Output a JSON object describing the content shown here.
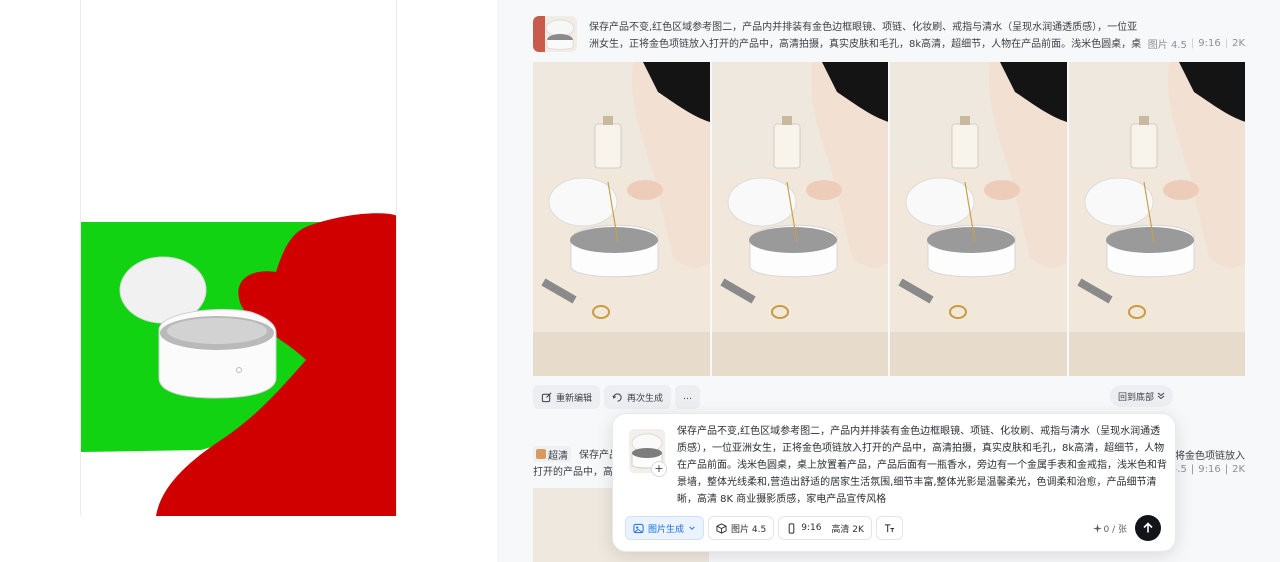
{
  "reference": {
    "region_colors": {
      "green": "#11d311",
      "red": "#d10000"
    },
    "product_name": "ultrasonic-cleaner"
  },
  "result": {
    "prompt": "保存产品不变,红色区域参考图二，产品内并排装有金色边框眼镜、项链、化妆刷、戒指与清水（呈现水润通透质感），一位亚洲女生，正将金色项链放入打开的产品中，高清拍摄，真实皮肤和毛孔，8k高清，超细节，人物在产品前面。浅米色圆桌，桌上放置着产品，产品后面有…",
    "meta": {
      "model": "图片 4.5",
      "ratio": "9:16",
      "resolution": "2K"
    },
    "images": [
      "result-1",
      "result-2",
      "result-3",
      "result-4"
    ],
    "actions": {
      "re_edit": "重新编辑",
      "regenerate": "再次生成",
      "more": "…"
    },
    "back_bottom": "回到底部"
  },
  "second": {
    "hd_tag": "超清",
    "prompt_start": "保存产品",
    "prompt_end": "将金色项链放入",
    "line2_start": "打开的产品中，高",
    "meta": {
      "model": "4.5",
      "ratio": "9:16",
      "resolution": "2K"
    }
  },
  "composer": {
    "prompt": "保存产品不变,红色区域参考图二，产品内并排装有金色边框眼镜、项链、化妆刷、戒指与清水（呈现水润通透质感），一位亚洲女生，正将金色项链放入打开的产品中，高清拍摄，真实皮肤和毛孔，8k高清，超细节，人物在产品前面。浅米色圆桌，桌上放置着产品，产品后面有一瓶香水，旁边有一个金属手表和金戒指，浅米色和背景墙，整体光线柔和,营造出舒适的居家生活氛围,细节丰富,整体光影是温馨柔光，色调柔和治愈，产品细节清晰，高清 8K 商业摄影质感，家电产品宣传风格",
    "mode": "图片生成",
    "model": "图片 4.5",
    "ratio": "9:16",
    "resolution": "高清 2K",
    "credits": "0 / 张",
    "add_glyph": "+"
  }
}
